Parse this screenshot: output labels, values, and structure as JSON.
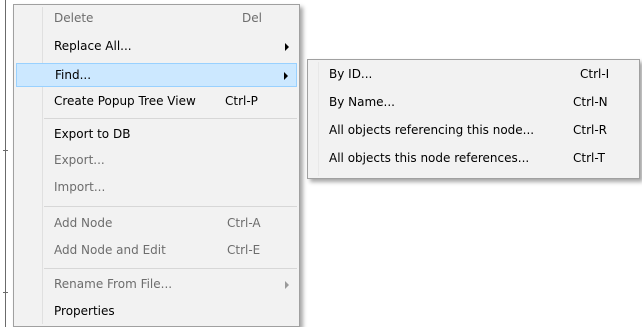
{
  "main_menu": {
    "items": [
      {
        "label": "Delete",
        "shortcut": "Del",
        "disabled": true
      },
      {
        "label": "Replace All...",
        "shortcut": "",
        "submenu": true
      },
      {
        "label": "Find...",
        "shortcut": "",
        "submenu": true,
        "highlighted": true
      },
      {
        "label": "Create Popup Tree View",
        "shortcut": "Ctrl-P"
      },
      {
        "label": "Export to DB",
        "shortcut": ""
      },
      {
        "label": "Export...",
        "shortcut": "",
        "disabled": true
      },
      {
        "label": "Import...",
        "shortcut": "",
        "disabled": true
      },
      {
        "label": "Add Node",
        "shortcut": "Ctrl-A",
        "disabled": true
      },
      {
        "label": "Add Node and Edit",
        "shortcut": "Ctrl-E",
        "disabled": true
      },
      {
        "label": "Rename From File...",
        "shortcut": "",
        "submenu": true,
        "disabled": true
      },
      {
        "label": "Properties",
        "shortcut": ""
      }
    ]
  },
  "find_submenu": {
    "items": [
      {
        "label": "By ID...",
        "shortcut": "Ctrl-I"
      },
      {
        "label": "By Name...",
        "shortcut": "Ctrl-N"
      },
      {
        "label": "All objects referencing this node...",
        "shortcut": "Ctrl-R"
      },
      {
        "label": "All objects this node references...",
        "shortcut": "Ctrl-T"
      }
    ]
  },
  "colors": {
    "menu_bg": "#f2f2f2",
    "highlight_bg": "#cce8ff",
    "highlight_border": "#99d1ff",
    "disabled_text": "#6d6d6d"
  }
}
